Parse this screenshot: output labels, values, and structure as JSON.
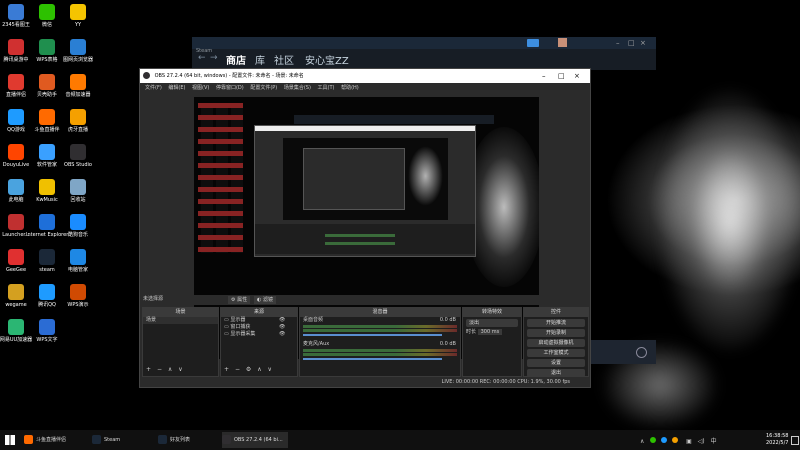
{
  "desktop_icons": [
    {
      "label": "2345看图王",
      "color": "#3a7bd5"
    },
    {
      "label": "微信",
      "color": "#2dc100"
    },
    {
      "label": "YY",
      "color": "#f5c400"
    },
    {
      "label": "腾讯桌游中",
      "color": "#d03030"
    },
    {
      "label": "WPS表格",
      "color": "#1f8f4e"
    },
    {
      "label": "图网页浏览器",
      "color": "#2a7fd4"
    },
    {
      "label": "直播伴侣",
      "color": "#e03a2f"
    },
    {
      "label": "贝壳助手",
      "color": "#e05a20"
    },
    {
      "label": "音频加速器",
      "color": "#ff7a00"
    },
    {
      "label": "QQ游戏",
      "color": "#1e9bff"
    },
    {
      "label": "斗鱼直播伴",
      "color": "#ff6a00"
    },
    {
      "label": "虎牙直播",
      "color": "#f5a000"
    },
    {
      "label": "DouyuLive",
      "color": "#ff4500"
    },
    {
      "label": "软件管家",
      "color": "#3aa0ff"
    },
    {
      "label": "OBS Studio",
      "color": "#302e31"
    },
    {
      "label": "此电脑",
      "color": "#4aa3df"
    },
    {
      "label": "KwMusic",
      "color": "#f0c000"
    },
    {
      "label": "回收站",
      "color": "#7fa6c6"
    },
    {
      "label": "Launcher...",
      "color": "#c03030"
    },
    {
      "label": "Internet Explorer",
      "color": "#1e6fd9"
    },
    {
      "label": "酷狗音乐",
      "color": "#1a8cff"
    },
    {
      "label": "GeeGee",
      "color": "#e03030"
    },
    {
      "label": "steam",
      "color": "#1b2838"
    },
    {
      "label": "电脑管家",
      "color": "#1e88e5"
    },
    {
      "label": "wegame",
      "color": "#d4a020"
    },
    {
      "label": "腾讯QQ",
      "color": "#1e9bff"
    },
    {
      "label": "WPS演示",
      "color": "#d04a02"
    },
    {
      "label": "网易UU加速器",
      "color": "#2bb673"
    },
    {
      "label": "WPS文字",
      "color": "#2b6cd4"
    }
  ],
  "steam": {
    "tabs": [
      "商店",
      "库",
      "社区",
      "安心宝ZZ"
    ],
    "tb_label": "Steam"
  },
  "obs": {
    "title": "OBS 27.2.4 (64 bit, windows) - 配置文件: 未命名 - 场景: 未命名",
    "menu": [
      "文件(F)",
      "编辑(E)",
      "视图(V)",
      "停靠窗口(D)",
      "配置文件(P)",
      "场景集合(S)",
      "工具(T)",
      "帮助(H)"
    ],
    "no_source": "未选择源",
    "prop_btn": "属性",
    "filter_btn": "滤镜",
    "panels": {
      "scenes": "场景",
      "sources": "来源",
      "mixer": "混音器",
      "transitions": "转场特效",
      "controls": "控件"
    },
    "scene_items": [
      "场景"
    ],
    "source_items": [
      "显示器",
      "窗口捕获",
      "显示器采集"
    ],
    "mixer": [
      {
        "name": "桌面音频",
        "level": "0.0 dB"
      },
      {
        "name": "麦克风/Aux",
        "level": "0.0 dB"
      }
    ],
    "transition": {
      "type": "淡出",
      "duration_label": "时长",
      "duration": "300 ms"
    },
    "controls": [
      "开始推流",
      "开始录制",
      "启动虚拟摄像机",
      "工作室模式",
      "设置",
      "退出"
    ],
    "status": "LIVE: 00:00:00   REC: 00:00:00   CPU: 1.9%, 30.00 fps"
  },
  "taskbar": {
    "tasks": [
      {
        "label": "斗鱼直播伴侣",
        "color": "#ff6a00"
      },
      {
        "label": "Steam",
        "color": "#1b2838"
      },
      {
        "label": "好友列表",
        "color": "#1b2838"
      },
      {
        "label": "OBS 27.2.4 (64 bi...",
        "color": "#302e31"
      }
    ],
    "time": "16:38:58",
    "date": "2022/5/7"
  }
}
